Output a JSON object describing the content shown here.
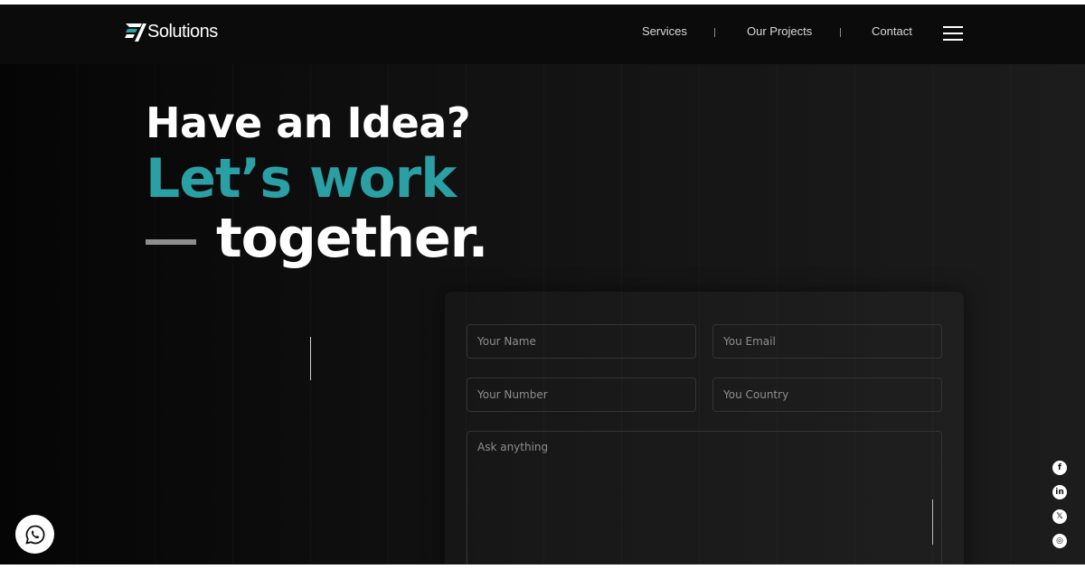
{
  "header": {
    "logo_text": "Solutions",
    "nav": [
      {
        "label": "Services"
      },
      {
        "label": "Our Projects"
      },
      {
        "label": "Contact"
      }
    ]
  },
  "hero": {
    "line1": "Have an Idea?",
    "line2": "Let’s work",
    "line3": "together."
  },
  "form": {
    "name_placeholder": "Your Name",
    "email_placeholder": "You Email",
    "number_placeholder": "Your Number",
    "country_placeholder": "You Country",
    "message_placeholder": "Ask anything"
  },
  "socials": [
    {
      "icon": "facebook-icon",
      "glyph": "f"
    },
    {
      "icon": "linkedin-icon",
      "glyph": "in"
    },
    {
      "icon": "x-icon",
      "glyph": "𝕏"
    },
    {
      "icon": "instagram-icon",
      "glyph": "◎"
    }
  ],
  "colors": {
    "accent": "#2aa0a4",
    "background": "#0b0b0b",
    "text": "#ffffff"
  }
}
